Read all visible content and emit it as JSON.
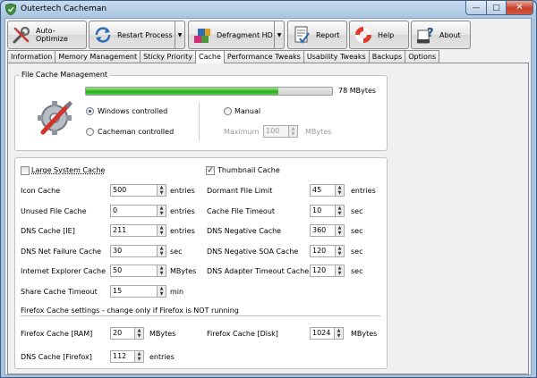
{
  "window": {
    "title": "Outertech Cacheman",
    "minimize": "—",
    "maximize": "□",
    "close": "✕"
  },
  "toolbar": {
    "auto_optimize": "Auto-Optimize",
    "restart_process": "Restart Process",
    "defragment_hd": "Defragment HD",
    "report": "Report",
    "help": "Help",
    "about": "About",
    "dropdown_arrow": "▼"
  },
  "tabs": [
    "Information",
    "Memory Management",
    "Sticky Priority",
    "Cache",
    "Performance Tweaks",
    "Usability Tweaks",
    "Backups",
    "Options"
  ],
  "active_tab": "Cache",
  "file_cache": {
    "title": "File Cache Management",
    "progress_fraction": 0.78,
    "progress_label": "78 MBytes",
    "windows_controlled": "Windows controlled",
    "cacheman_controlled": "Cacheman controlled",
    "manual": "Manual",
    "maximum_label": "Maximum",
    "maximum_value": "100",
    "maximum_unit": "MBytes",
    "selected": "Windows controlled"
  },
  "settings": {
    "large_system_cache": "Large System Cache",
    "large_system_cache_checked": false,
    "thumbnail_cache": "Thumbnail Cache",
    "thumbnail_cache_checked": true,
    "left": [
      {
        "label": "Icon Cache",
        "value": "500",
        "unit": "entries"
      },
      {
        "label": "Unused File Cache",
        "value": "0",
        "unit": "entries"
      },
      {
        "label": "DNS Cache [IE]",
        "value": "211",
        "unit": "entries"
      },
      {
        "label": "DNS Net Failure Cache",
        "value": "30",
        "unit": "sec"
      },
      {
        "label": "Internet Explorer Cache",
        "value": "50",
        "unit": "MBytes"
      },
      {
        "label": "Share Cache Timeout",
        "value": "15",
        "unit": "min"
      }
    ],
    "right": [
      {
        "label": "Dormant File Limit",
        "value": "45",
        "unit": "entries"
      },
      {
        "label": "Cache File Timeout",
        "value": "10",
        "unit": "sec"
      },
      {
        "label": "DNS Negative Cache",
        "value": "360",
        "unit": "sec"
      },
      {
        "label": "DNS Negative SOA Cache",
        "value": "120",
        "unit": "sec"
      },
      {
        "label": "DNS Adapter Timeout Cache",
        "value": "120",
        "unit": "sec"
      }
    ],
    "firefox_note": "Firefox Cache settings - change only if Firefox is NOT running",
    "firefox_ram": {
      "label": "Firefox Cache [RAM]",
      "value": "20",
      "unit": "MBytes"
    },
    "firefox_disk": {
      "label": "Firefox Cache [Disk]",
      "value": "1024",
      "unit": "MBytes"
    },
    "firefox_dns": {
      "label": "DNS Cache [Firefox]",
      "value": "112",
      "unit": "entries"
    }
  },
  "spin_up": "▲",
  "spin_down": "▼",
  "check_mark": "✓",
  "colors": {
    "progress_green": "#3dbb2c",
    "title_bar": "#a9c4e1",
    "close_red": "#c7422b"
  }
}
